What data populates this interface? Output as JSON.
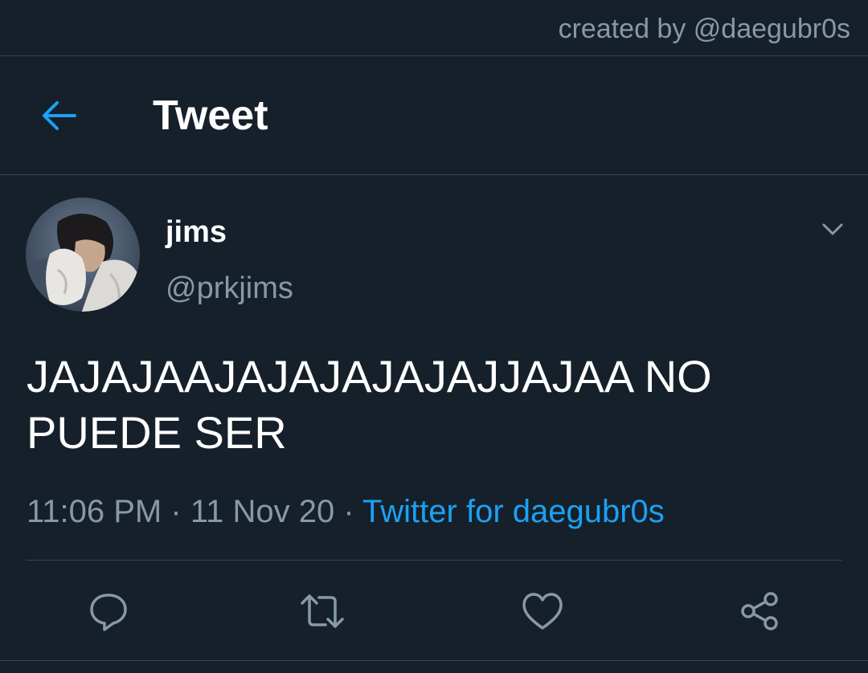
{
  "credit": "created by @daegubr0s",
  "header": {
    "title": "Tweet",
    "back_icon": "arrow-left-icon"
  },
  "tweet": {
    "display_name": "jims",
    "handle": "@prkjims",
    "text_line1": "JAJAJAAJAJAJAJAJAJJAJAA NO",
    "text_line2": "PUEDE SER",
    "time": "11:06 PM",
    "date": "11 Nov 20",
    "separator": "·",
    "source": "Twitter for daegubr0s"
  },
  "actions": [
    {
      "name": "reply",
      "icon": "comment-icon"
    },
    {
      "name": "retweet",
      "icon": "retweet-icon"
    },
    {
      "name": "like",
      "icon": "heart-icon"
    },
    {
      "name": "share",
      "icon": "share-icon"
    }
  ],
  "colors": {
    "background": "#15202b",
    "accent": "#1da1f2",
    "secondary_text": "#8899a6",
    "border": "#38444d"
  }
}
